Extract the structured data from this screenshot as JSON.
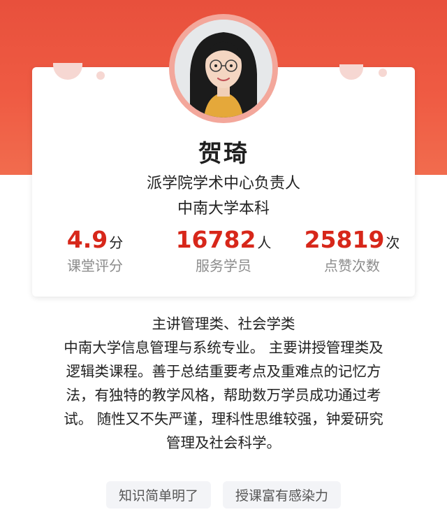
{
  "teacher": {
    "name": "贺琦",
    "title": "派学院学术中心负责人",
    "education": "中南大学本科",
    "avatar_icon": "teacher-portrait"
  },
  "stats": [
    {
      "value": "4.9",
      "unit": "分",
      "label": "课堂评分"
    },
    {
      "value": "16782",
      "unit": "人",
      "label": "服务学员"
    },
    {
      "value": "25819",
      "unit": "次",
      "label": "点赞次数"
    }
  ],
  "description": {
    "lines": [
      "主讲管理类、社会学类",
      "中南大学信息管理与系统专业。 主要讲授管理类及",
      "逻辑类课程。善于总结重要考点及重难点的记忆方",
      "法，有独特的教学风格，帮助数万学员成功通过考",
      "试。 随性又不失严谨，理科性思维较强，钟爱研究",
      "管理及社会科学。"
    ]
  },
  "tags": [
    "知识简单明了",
    "授课富有感染力"
  ],
  "colors": {
    "hero_red": "#e8503c",
    "stat_red": "#d7271a",
    "label_gray": "#8c8c8c",
    "tag_bg": "#f3f4f7"
  }
}
